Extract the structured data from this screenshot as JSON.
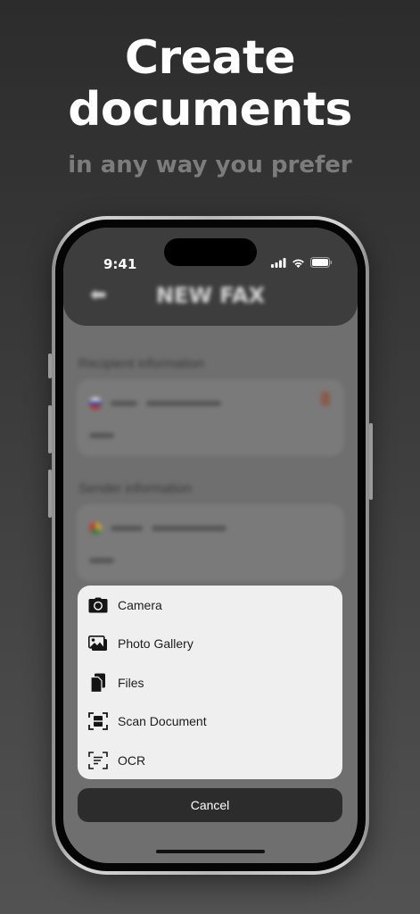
{
  "promo": {
    "title": "Create documents",
    "subtitle": "in any way you prefer"
  },
  "status_bar": {
    "time": "9:41"
  },
  "app": {
    "title": "NEW FAX",
    "recipient_section": "Recipient information",
    "sender_section": "Sender information"
  },
  "action_sheet": {
    "items": [
      {
        "label": "Camera",
        "icon": "camera-icon"
      },
      {
        "label": "Photo Gallery",
        "icon": "photo-gallery-icon"
      },
      {
        "label": "Files",
        "icon": "files-icon"
      },
      {
        "label": "Scan Document",
        "icon": "scan-document-icon"
      },
      {
        "label": "OCR",
        "icon": "ocr-icon"
      }
    ],
    "cancel_label": "Cancel"
  },
  "colors": {
    "sheet_background": "#efefef",
    "cancel_background": "#2c2c2c",
    "page_background": "#2c2c2c"
  }
}
